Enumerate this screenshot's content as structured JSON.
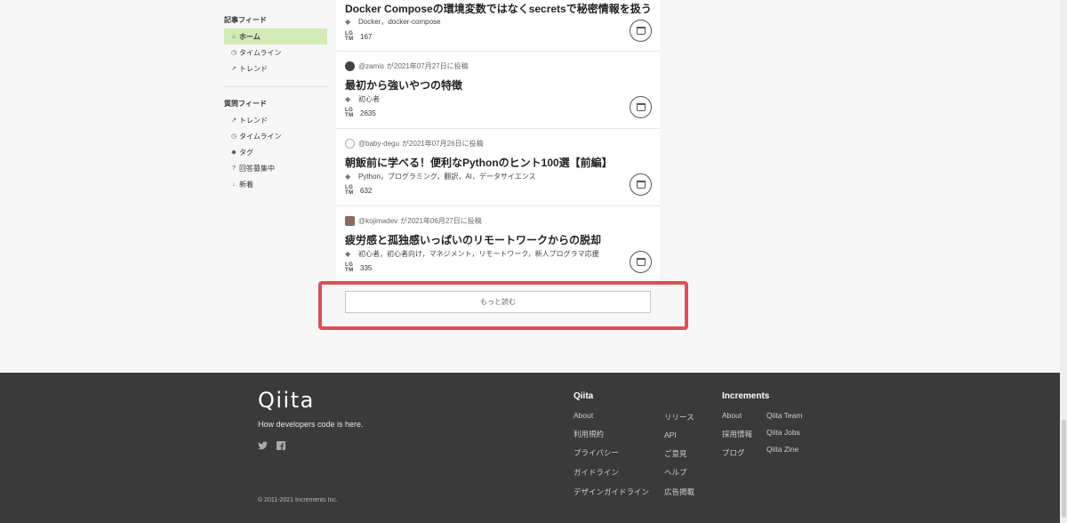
{
  "sidebar": {
    "article_heading": "記事フィード",
    "article_items": [
      {
        "label": "ホーム",
        "icon": "home-icon"
      },
      {
        "label": "タイムライン",
        "icon": "clock-icon"
      },
      {
        "label": "トレンド",
        "icon": "trend-icon"
      }
    ],
    "question_heading": "質問フィード",
    "question_items": [
      {
        "label": "トレンド",
        "icon": "trend-icon"
      },
      {
        "label": "タイムライン",
        "icon": "clock-icon"
      },
      {
        "label": "タグ",
        "icon": "tag-icon"
      },
      {
        "label": "回答募集中",
        "icon": "question-icon"
      },
      {
        "label": "新着",
        "icon": "sort-icon"
      }
    ]
  },
  "articles": [
    {
      "title": "Docker Composeの環境変数ではなくsecretsで秘密情報を扱う",
      "tags": "Docker，docker-compose",
      "lgtm": "167"
    },
    {
      "user": "@zamis",
      "posted": "が2021年07月27日に投稿",
      "title": "最初から強いやつの特徴",
      "tags": "初心者",
      "lgtm": "2635"
    },
    {
      "user": "@baby-degu",
      "posted": "が2021年07月26日に投稿",
      "title": "朝飯前に学べる！便利なPythonのヒント100選【前編】",
      "tags": "Python，プログラミング，翻訳，AI，データサイエンス",
      "lgtm": "632"
    },
    {
      "user": "@kojimadev",
      "posted": "が2021年06月27日に投稿",
      "title": "疲労感と孤独感いっぱいのリモートワークからの脱却",
      "tags": "初心者，初心者向け，マネジメント，リモートワーク，新人プログラマ応援",
      "lgtm": "335"
    }
  ],
  "lgtm_label_top": "LG",
  "lgtm_label_bottom": "TM",
  "more_button": "もっと読む",
  "footer": {
    "logo": "Qiita",
    "tagline": "How developers code is here.",
    "copyright": "© 2011-2021 Increments Inc.",
    "qiita_heading": "Qiita",
    "qiita_col1": [
      "About",
      "利用規約",
      "プライバシー",
      "ガイドライン",
      "デザインガイドライン"
    ],
    "qiita_col2": [
      "リリース",
      "API",
      "ご意見",
      "ヘルプ",
      "広告掲載"
    ],
    "increments_heading": "Increments",
    "increments_col1": [
      "About",
      "採用情報",
      "ブログ"
    ],
    "increments_col2": [
      "Qiita Team",
      "Qiita Jobs",
      "Qiita Zine"
    ]
  },
  "colors": {
    "active_nav": "#d3ebb8",
    "highlight": "#e04e54",
    "footer_bg": "#3a3a3a"
  }
}
